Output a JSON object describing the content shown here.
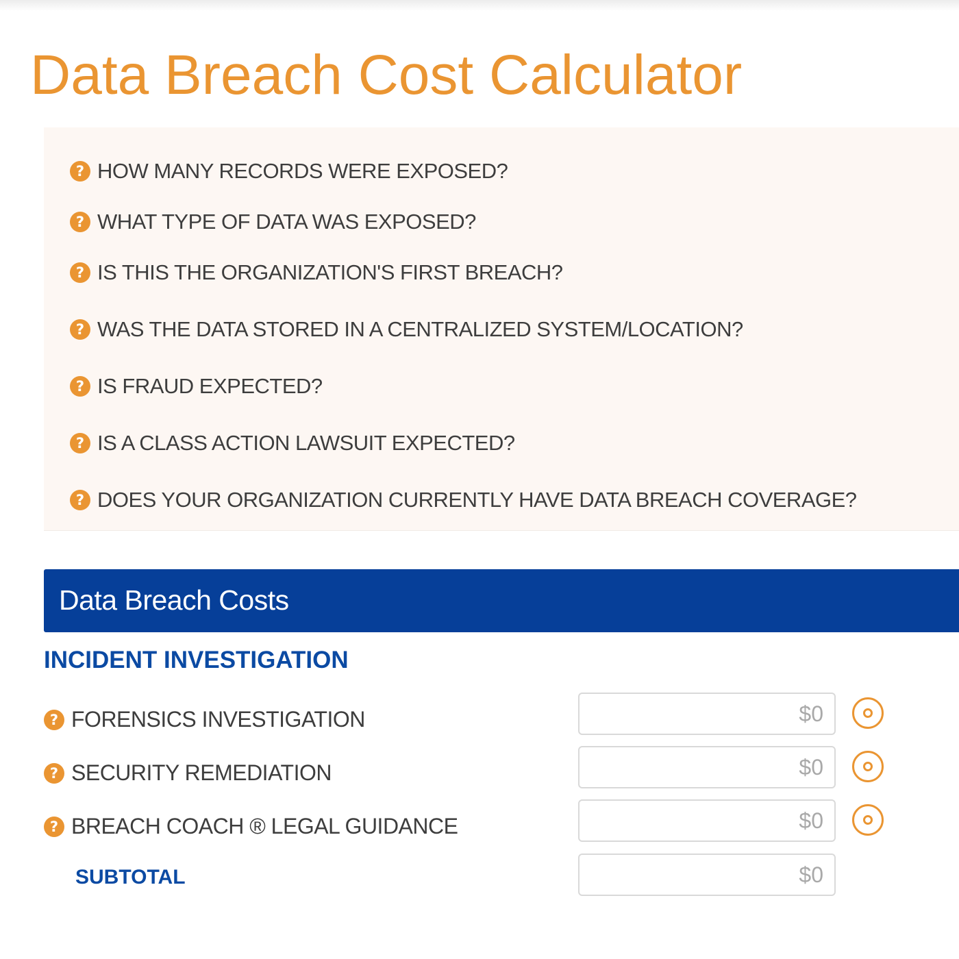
{
  "page": {
    "title": "Data Breach Cost Calculator"
  },
  "questions": [
    {
      "label": "HOW MANY RECORDS WERE EXPOSED?",
      "icon": "help-icon"
    },
    {
      "label": "WHAT TYPE OF DATA WAS EXPOSED?",
      "icon": "help-icon"
    },
    {
      "label": "IS THIS THE ORGANIZATION'S FIRST BREACH?",
      "icon": "help-icon"
    },
    {
      "label": "WAS THE DATA STORED IN A CENTRALIZED SYSTEM/LOCATION?",
      "icon": "help-icon"
    },
    {
      "label": "IS FRAUD EXPECTED?",
      "icon": "help-icon"
    },
    {
      "label": "IS A CLASS ACTION LAWSUIT EXPECTED?",
      "icon": "help-icon"
    },
    {
      "label": "DOES YOUR ORGANIZATION CURRENTLY HAVE DATA BREACH COVERAGE?",
      "icon": "help-icon"
    }
  ],
  "costs": {
    "header": "Data Breach Costs",
    "section": "INCIDENT INVESTIGATION",
    "rows": [
      {
        "label": "FORENSICS INVESTIGATION",
        "placeholder": "$0",
        "icon": "help-icon",
        "action_icon": "target-icon"
      },
      {
        "label": "SECURITY REMEDIATION",
        "placeholder": "$0",
        "icon": "help-icon",
        "action_icon": "target-icon"
      },
      {
        "label": "BREACH COACH ® LEGAL GUIDANCE",
        "placeholder": "$0",
        "icon": "help-icon",
        "action_icon": "target-icon"
      }
    ],
    "subtotal": {
      "label": "SUBTOTAL",
      "placeholder": "$0"
    }
  },
  "colors": {
    "accent_orange": "#ea9532",
    "header_blue": "#063f99",
    "heading_blue": "#0b4aa3",
    "panel_bg": "#fdf7f3"
  },
  "icon_glyphs": {
    "help": "?"
  }
}
